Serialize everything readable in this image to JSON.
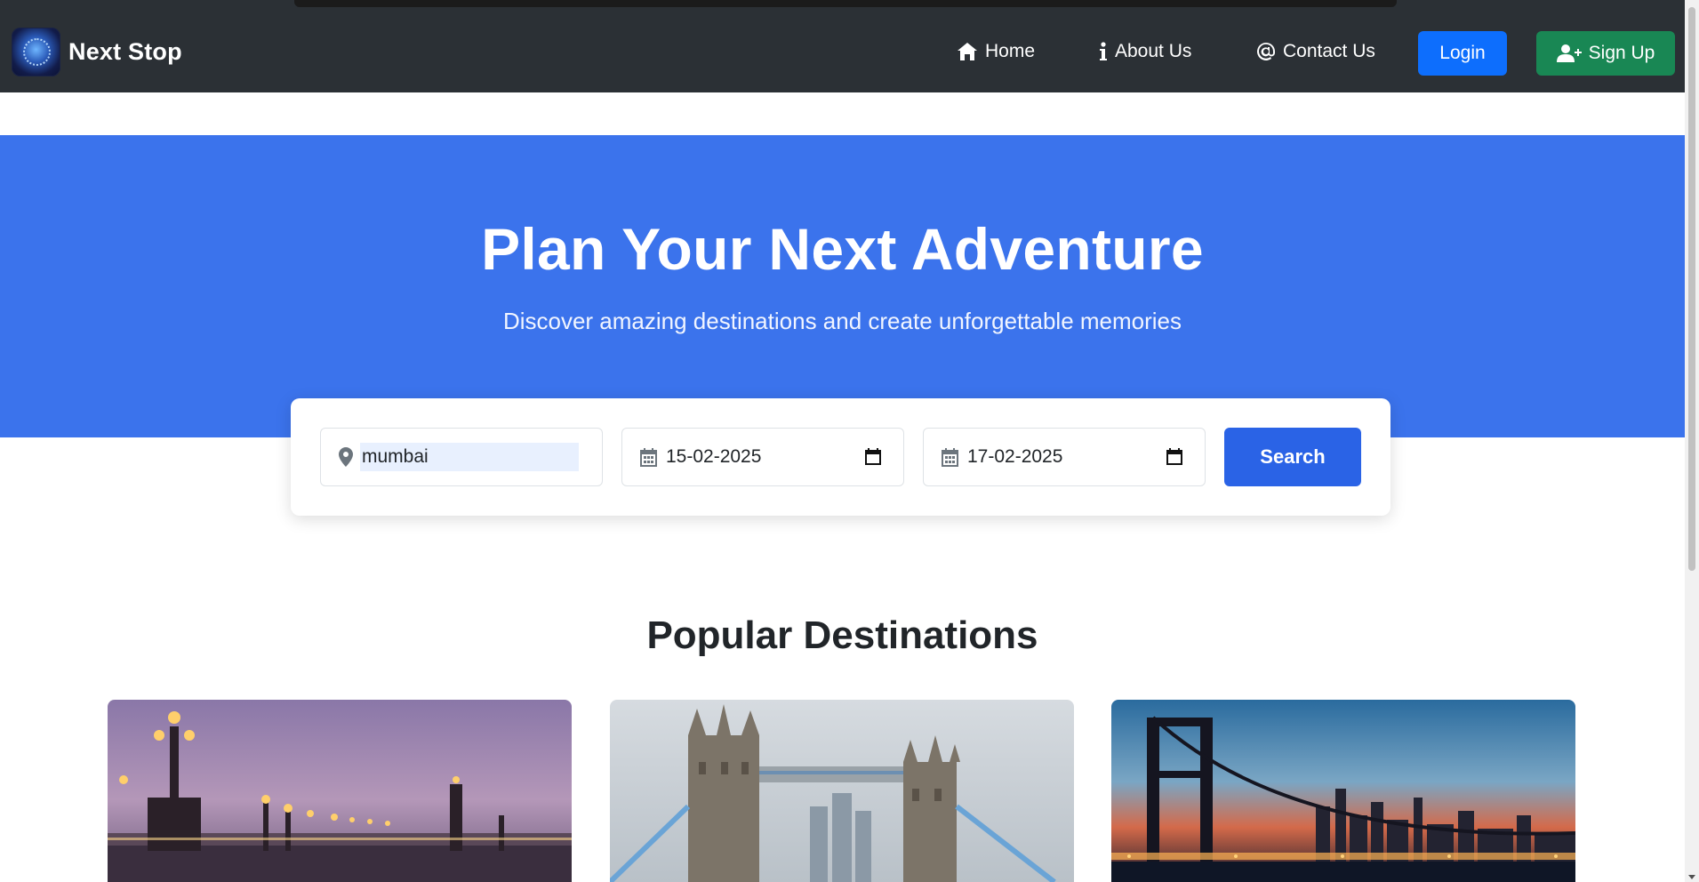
{
  "brand": {
    "name": "Next Stop"
  },
  "nav": {
    "home": "Home",
    "about": "About Us",
    "contact": "Contact Us",
    "login": "Login",
    "signup": "Sign Up"
  },
  "hero": {
    "title": "Plan Your Next Adventure",
    "subtitle": "Discover amazing destinations and create unforgettable memories"
  },
  "search": {
    "location_value": "mumbai",
    "start_date": "15-02-2025",
    "end_date": "17-02-2025",
    "button_label": "Search"
  },
  "popular": {
    "title": "Popular Destinations",
    "cards": [
      {
        "image": "paris-bridge-lamps-dusk"
      },
      {
        "image": "london-tower-bridge"
      },
      {
        "image": "new-york-bridge-night-skyline"
      }
    ]
  },
  "colors": {
    "navbar": "#2b3035",
    "hero": "#3b73ec",
    "login": "#0d6efd",
    "signup": "#198754",
    "search_button": "#2a63e6"
  }
}
